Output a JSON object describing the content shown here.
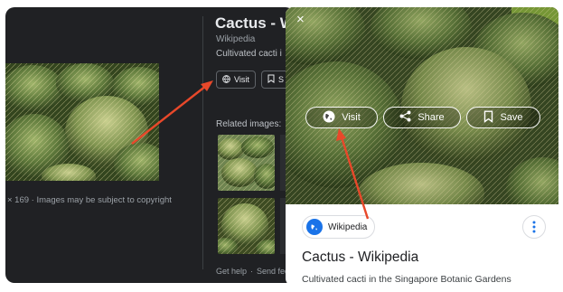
{
  "desktop": {
    "title": "Cactus - Wi",
    "source": "Wikipedia",
    "caption": "Cultivated cacti i",
    "visit_label": "Visit",
    "save_label": "S",
    "related_label": "Related images:",
    "copyright": "× 169 · Images may be subject to copyright",
    "footer": {
      "help": "Get help",
      "feedback": "Send feed"
    }
  },
  "mobile": {
    "close_glyph": "×",
    "visit_label": "Visit",
    "share_label": "Share",
    "save_label": "Save",
    "source_chip": "Wikipedia",
    "title": "Cactus - Wikipedia",
    "caption": "Cultivated cacti in the Singapore Botanic Gardens"
  },
  "colors": {
    "dark_bg": "#202124",
    "arrow": "#e8482a",
    "cactus_green": "#5f7a3c",
    "link_blue": "#1a73e8"
  },
  "icons": [
    "globe-icon",
    "bookmark-icon",
    "share-icon",
    "close-icon",
    "more-vert-icon"
  ]
}
